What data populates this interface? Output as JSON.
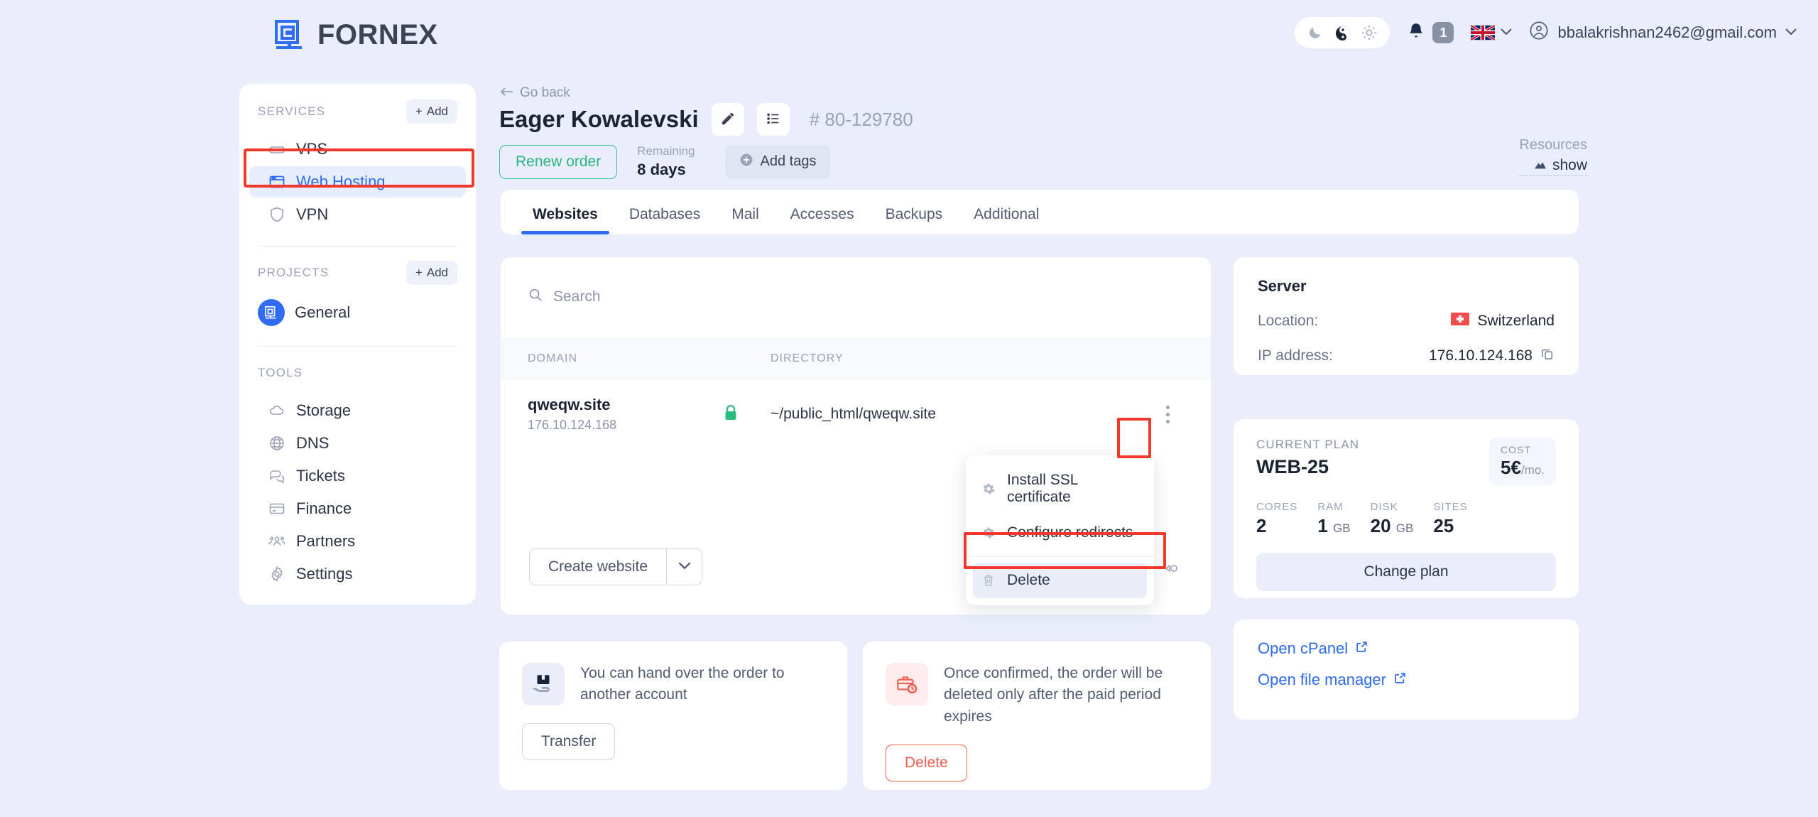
{
  "brand": {
    "name": "FORNEX",
    "logo_icon": "fornex-logo-icon",
    "accent": "#2f6bf5"
  },
  "topbar": {
    "theme": {
      "moon_icon": "moon-icon",
      "auto_icon": "yin-yang-icon",
      "sun_icon": "sun-icon"
    },
    "notifications": {
      "icon": "bell-icon",
      "count": "1"
    },
    "language": {
      "flag": "uk-flag-icon",
      "caret": "chevron-down-icon"
    },
    "account": {
      "avatar_icon": "user-circle-icon",
      "email": "bbalakrishnan2462@gmail.com",
      "caret": "chevron-down-icon"
    }
  },
  "sidebar": {
    "services": {
      "title": "SERVICES",
      "add_label": "Add",
      "items": [
        {
          "label": "VPS",
          "icon": "server-icon",
          "active": false
        },
        {
          "label": "Web Hosting",
          "icon": "browser-window-icon",
          "active": true
        },
        {
          "label": "VPN",
          "icon": "shield-icon",
          "active": false
        }
      ]
    },
    "projects": {
      "title": "PROJECTS",
      "add_label": "Add",
      "items": [
        {
          "label": "General",
          "icon": "project-avatar-icon"
        }
      ]
    },
    "tools": {
      "title": "TOOLS",
      "items": [
        {
          "label": "Storage",
          "icon": "cloud-icon"
        },
        {
          "label": "DNS",
          "icon": "globe-icon"
        },
        {
          "label": "Tickets",
          "icon": "chat-bubbles-icon"
        },
        {
          "label": "Finance",
          "icon": "credit-card-icon"
        },
        {
          "label": "Partners",
          "icon": "people-icon"
        },
        {
          "label": "Settings",
          "icon": "gear-icon"
        }
      ]
    }
  },
  "header": {
    "go_back": "Go back",
    "title": "Eager Kowalevski",
    "edit_icon": "pencil-icon",
    "list_icon": "list-icon",
    "order_number": "# 80-129780",
    "renew_label": "Renew order",
    "remaining_label": "Remaining",
    "remaining_value": "8 days",
    "add_tags_label": "Add tags",
    "resources_label": "Resources",
    "resources_show": "show",
    "resources_icon": "chart-icon"
  },
  "tabs": [
    {
      "label": "Websites",
      "active": true
    },
    {
      "label": "Databases",
      "active": false
    },
    {
      "label": "Mail",
      "active": false
    },
    {
      "label": "Accesses",
      "active": false
    },
    {
      "label": "Backups",
      "active": false
    },
    {
      "label": "Additional",
      "active": false
    }
  ],
  "websites": {
    "search_placeholder": "Search",
    "search_value": "",
    "search_icon": "search-icon",
    "columns": {
      "domain": "DOMAIN",
      "directory": "DIRECTORY"
    },
    "rows": [
      {
        "domain": "qweqw.site",
        "ip": "176.10.124.168",
        "ssl_icon": "lock-icon",
        "directory": "~/public_html/qweqw.site",
        "menu_icon": "kebab-menu-icon"
      }
    ],
    "create_label": "Create website",
    "create_caret_icon": "chevron-down-icon"
  },
  "context_menu": {
    "items": [
      {
        "label": "Install SSL certificate",
        "icon": "gear-icon",
        "highlighted": false
      },
      {
        "label": "Configure redirects",
        "icon": "gear-icon",
        "highlighted": false
      },
      {
        "label": "Delete",
        "icon": "trash-icon",
        "highlighted": true
      }
    ]
  },
  "server_card": {
    "title": "Server",
    "location_label": "Location:",
    "location_value": "Switzerland",
    "location_flag": "switzerland-flag-icon",
    "ip_label": "IP address:",
    "ip_value": "176.10.124.168",
    "copy_icon": "copy-icon"
  },
  "plan_card": {
    "label": "CURRENT PLAN",
    "name": "WEB-25",
    "cost_label": "COST",
    "cost_value": "5€",
    "cost_unit": "/mo.",
    "specs": [
      {
        "label": "CORES",
        "value": "2",
        "unit": ""
      },
      {
        "label": "RAM",
        "value": "1",
        "unit": "GB"
      },
      {
        "label": "DISK",
        "value": "20",
        "unit": "GB"
      },
      {
        "label": "SITES",
        "value": "25",
        "unit": ""
      }
    ],
    "change_label": "Change plan"
  },
  "links_card": {
    "links": [
      {
        "label": "Open cPanel",
        "icon": "external-link-icon"
      },
      {
        "label": "Open file manager",
        "icon": "external-link-icon"
      }
    ]
  },
  "transfer_card": {
    "icon": "hand-package-icon",
    "text": "You can hand over the order to another account",
    "button": "Transfer"
  },
  "delete_card": {
    "icon": "briefcase-clock-icon",
    "text": "Once confirmed, the order will be deleted only after the paid period expires",
    "button": "Delete"
  },
  "highlights": {
    "color": "#f3372b"
  }
}
